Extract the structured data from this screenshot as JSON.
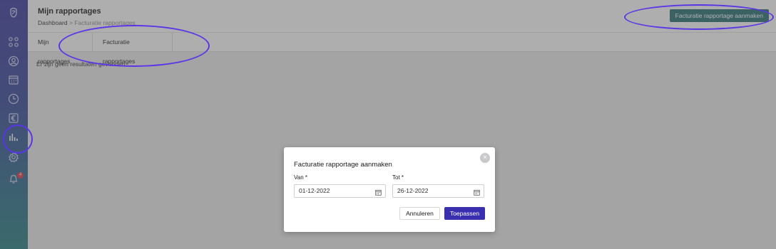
{
  "header": {
    "title": "Mijn rapportages",
    "breadcrumb": {
      "root": "Dashboard",
      "separator": ">",
      "current": "Facturatie rapportages"
    },
    "primary_button": "Facturatie rapportage aanmaken"
  },
  "tabs": [
    {
      "label": "Mijn rapportages"
    },
    {
      "label": "Facturatie rapportages"
    }
  ],
  "empty_state": "Er zijn geen resultaten gevonden",
  "sidebar": {
    "icons": [
      "logo-icon",
      "dashboard-grid-icon",
      "user-icon",
      "calendar-icon",
      "clock-icon",
      "euro-icon",
      "reports-chart-icon",
      "settings-gear-icon",
      "bell-icon"
    ],
    "notification_count": "4"
  },
  "modal": {
    "title": "Facturatie rapportage aanmaken",
    "from_label": "Van *",
    "from_value": "01-12-2022",
    "to_label": "Tot *",
    "to_value": "26-12-2022",
    "cancel": "Annuleren",
    "apply": "Toepassen",
    "close": "×"
  },
  "colors": {
    "sidebar_top": "#3d3a9e",
    "sidebar_bottom": "#2b8083",
    "primary_teal": "#2c6f74",
    "apply_purple": "#3a2fb0",
    "annotation": "#5a35e8"
  }
}
